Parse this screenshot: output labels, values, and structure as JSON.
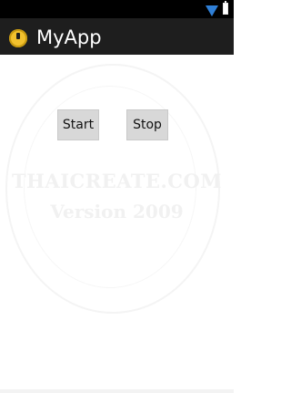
{
  "status_bar": {
    "icons": [
      "signal-icon",
      "battery-icon"
    ],
    "signal_color": "#2f7fd6"
  },
  "action_bar": {
    "icon": "app-icon",
    "title": "MyApp",
    "background": "#1e1e1e"
  },
  "buttons": {
    "start_label": "Start",
    "stop_label": "Stop"
  },
  "watermark": {
    "line1": "THAICREATE.COM",
    "line2": "Version 2009"
  }
}
